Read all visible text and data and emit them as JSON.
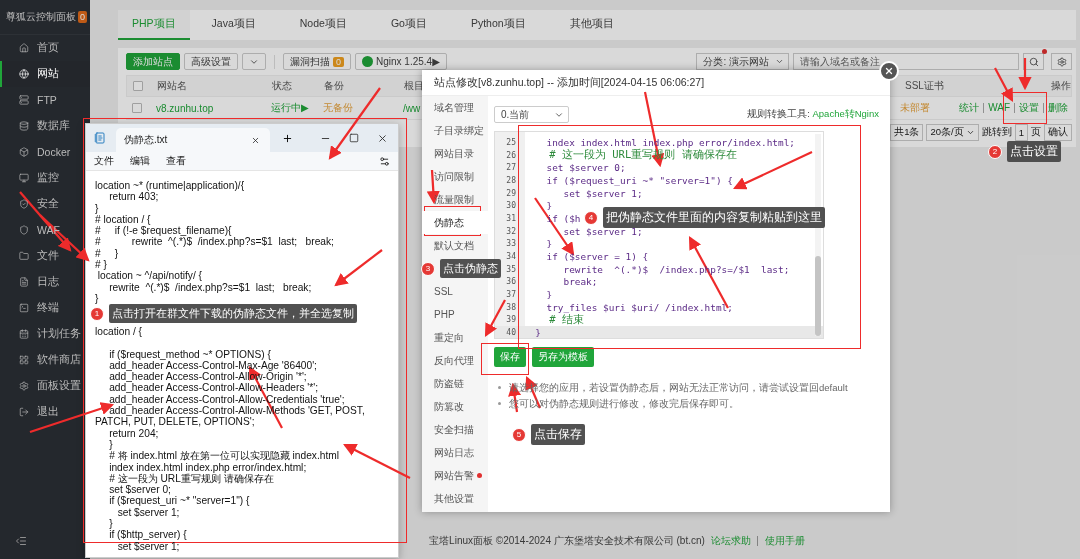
{
  "sidebar": {
    "brand": "尊狐云控制面板",
    "badge": "0",
    "items": [
      {
        "label": "首页",
        "selected": false
      },
      {
        "label": "网站",
        "selected": true
      },
      {
        "label": "FTP",
        "selected": false
      },
      {
        "label": "数据库",
        "selected": false
      },
      {
        "label": "Docker",
        "selected": false
      },
      {
        "label": "监控",
        "selected": false
      },
      {
        "label": "安全",
        "selected": false
      },
      {
        "label": "WAF",
        "selected": false
      },
      {
        "label": "文件",
        "selected": false
      },
      {
        "label": "日志",
        "selected": false
      },
      {
        "label": "终端",
        "selected": false
      },
      {
        "label": "计划任务",
        "selected": false
      },
      {
        "label": "软件商店",
        "selected": false
      },
      {
        "label": "面板设置",
        "selected": false
      },
      {
        "label": "退出",
        "selected": false
      }
    ]
  },
  "tabs": [
    {
      "label": "PHP项目",
      "selected": true
    },
    {
      "label": "Java项目",
      "selected": false
    },
    {
      "label": "Node项目",
      "selected": false
    },
    {
      "label": "Go项目",
      "selected": false
    },
    {
      "label": "Python项目",
      "selected": false
    },
    {
      "label": "其他项目",
      "selected": false
    }
  ],
  "toolbar": {
    "add_button": "添加站点",
    "advanced_button": "高级设置",
    "scan_button": "漏洞扫描",
    "scan_badge": "0",
    "nginx_button": "Nginx 1.25.4▶",
    "category_select": "分类: 演示网站",
    "search": {
      "placeholder": "请输入域名或备注"
    }
  },
  "table": {
    "header_checked": false,
    "columns_left": [
      "网站名",
      "状态",
      "备份",
      "根目"
    ],
    "columns_right": [
      "SSL证书",
      "操作"
    ],
    "rows": [
      {
        "checked": false,
        "name": "v8.zunhu.top",
        "status": "运行中▶",
        "backup": "无备份",
        "root": "/ww",
        "ssl": "未部署",
        "actions": [
          "统计",
          "WAF",
          "设置",
          "删除"
        ]
      }
    ]
  },
  "pagination": {
    "total": "共1条",
    "per_page": "20条/页",
    "jump_label": "跳转到",
    "page_input": "1",
    "page_unit": "页",
    "confirm": "确认"
  },
  "footer": {
    "copyright": "宝塔Linux面板 ©2014-2024 广东堡塔安全技术有限公司 (bt.cn)",
    "links": [
      "论坛求助",
      "使用手册"
    ]
  },
  "modal": {
    "title": "站点修改[v8.zunhu.top] -- 添加时间[2024-04-15 06:06:27]",
    "menu_top": [
      {
        "label": "域名管理",
        "selected": false,
        "alert": false
      },
      {
        "label": "子目录绑定",
        "selected": false,
        "alert": false
      },
      {
        "label": "网站目录",
        "selected": false,
        "alert": false
      },
      {
        "label": "访问限制",
        "selected": false,
        "alert": false
      },
      {
        "label": "流量限制",
        "selected": false,
        "alert": false
      },
      {
        "label": "伪静态",
        "selected": true,
        "alert": false
      },
      {
        "label": "默认文档",
        "selected": false,
        "alert": false
      }
    ],
    "menu_bottom": [
      {
        "label": "SSL",
        "selected": false,
        "alert": false
      },
      {
        "label": "PHP",
        "selected": false,
        "alert": false
      },
      {
        "label": "重定向",
        "selected": false,
        "alert": false
      },
      {
        "label": "反向代理",
        "selected": false,
        "alert": false
      },
      {
        "label": "防盗链",
        "selected": false,
        "alert": false
      },
      {
        "label": "防篡改",
        "selected": false,
        "alert": false
      },
      {
        "label": "安全扫描",
        "selected": false,
        "alert": false
      },
      {
        "label": "网站日志",
        "selected": false,
        "alert": false
      },
      {
        "label": "网站告警",
        "selected": false,
        "alert": true
      },
      {
        "label": "其他设置",
        "selected": false,
        "alert": false
      }
    ],
    "version_select": "0.当前",
    "converter_label": "规则转换工具:",
    "converter_link": "Apache转Nginx",
    "code_lines": [
      {
        "number": "25",
        "current": false,
        "kind": "code",
        "text": "    index index.html index.php error/index.html;"
      },
      {
        "number": "26",
        "current": false,
        "kind": "comment",
        "text": "    # 这一段为 URL重写规则 请确保存在"
      },
      {
        "number": "27",
        "current": false,
        "kind": "code",
        "text": "    set $server 0;"
      },
      {
        "number": "28",
        "current": false,
        "kind": "code",
        "text": "    if ($request_uri ~* \"server=1\") {"
      },
      {
        "number": "29",
        "current": false,
        "kind": "code",
        "text": "       set $server 1;"
      },
      {
        "number": "30",
        "current": false,
        "kind": "code",
        "text": "    }"
      },
      {
        "number": "31",
        "current": false,
        "kind": "code",
        "text": "    if ($h"
      },
      {
        "number": "32",
        "current": false,
        "kind": "code",
        "text": "       set $server 1;"
      },
      {
        "number": "33",
        "current": false,
        "kind": "code",
        "text": "    }"
      },
      {
        "number": "34",
        "current": false,
        "kind": "code",
        "text": "    if ($server = 1) {"
      },
      {
        "number": "35",
        "current": false,
        "kind": "code",
        "text": "       rewrite  ^(.*)$  /index.php?s=/$1  last;"
      },
      {
        "number": "36",
        "current": false,
        "kind": "code",
        "text": "       break;"
      },
      {
        "number": "37",
        "current": false,
        "kind": "code",
        "text": "    }"
      },
      {
        "number": "38",
        "current": false,
        "kind": "code",
        "text": "    try_files $uri $uri/ /index.html;"
      },
      {
        "number": "39",
        "current": false,
        "kind": "comment",
        "text": "    # 结束"
      },
      {
        "number": "40",
        "current": true,
        "kind": "code",
        "text": "  }"
      }
    ],
    "buttons": [
      "保存",
      "另存为模板"
    ],
    "notes": [
      "请选择您的应用，若设置伪静态后，网站无法正常访问，请尝试设置回default",
      "您可以对伪静态规则进行修改，修改完后保存即可。"
    ]
  },
  "notepad": {
    "tab": "伪静态.txt",
    "menu": [
      "文件",
      "编辑",
      "查看"
    ],
    "blocks": [
      [
        "location ~* (runtime|application)/{",
        "     return 403;",
        "}",
        "# location / {",
        "#     if (!-e $request_filename){",
        "#           rewrite  ^(.*)$  /index.php?s=$1  last;   break;",
        "#     }",
        "# }",
        " location ~ ^/api/notify/ {",
        "     rewrite  ^(.*)$  /index.php?s=$1  last;   break;",
        "}"
      ],
      [
        "location / {"
      ],
      [
        "     if ($request_method ~* OPTIONS) {",
        "     add_header Access-Control-Max-Age '86400';",
        "     add_header Access-Control-Allow-Origin '*';",
        "     add_header Access-Control-Allow-Headers '*';",
        "     add_header Access-Control-Allow-Credentials 'true';",
        "     add_header Access-Control-Allow-Methods 'GET, POST, PATCH, PUT, DELETE, OPTIONS';",
        "     return 204;",
        "     }",
        "     # 将 index.html 放在第一位可以实现隐藏 index.html",
        "     index index.html index.php error/index.html;",
        "     # 这一段为 URL重写规则 请确保存在",
        "     set $server 0;",
        "     if ($request_uri ~* \"server=1\") {",
        "        set $server 1;",
        "     }",
        "     if ($http_server) {",
        "        set $server 1;"
      ]
    ]
  },
  "callouts": [
    {
      "number": "1",
      "text": "点击打开在群文件下载的伪静态文件，并全选复制"
    },
    {
      "number": "2",
      "text": "点击设置"
    },
    {
      "number": "3",
      "text": "点击伪静态"
    },
    {
      "number": "4",
      "text": "把伪静态文件里面的内容复制粘贴到这里"
    },
    {
      "number": "5",
      "text": "点击保存"
    }
  ]
}
